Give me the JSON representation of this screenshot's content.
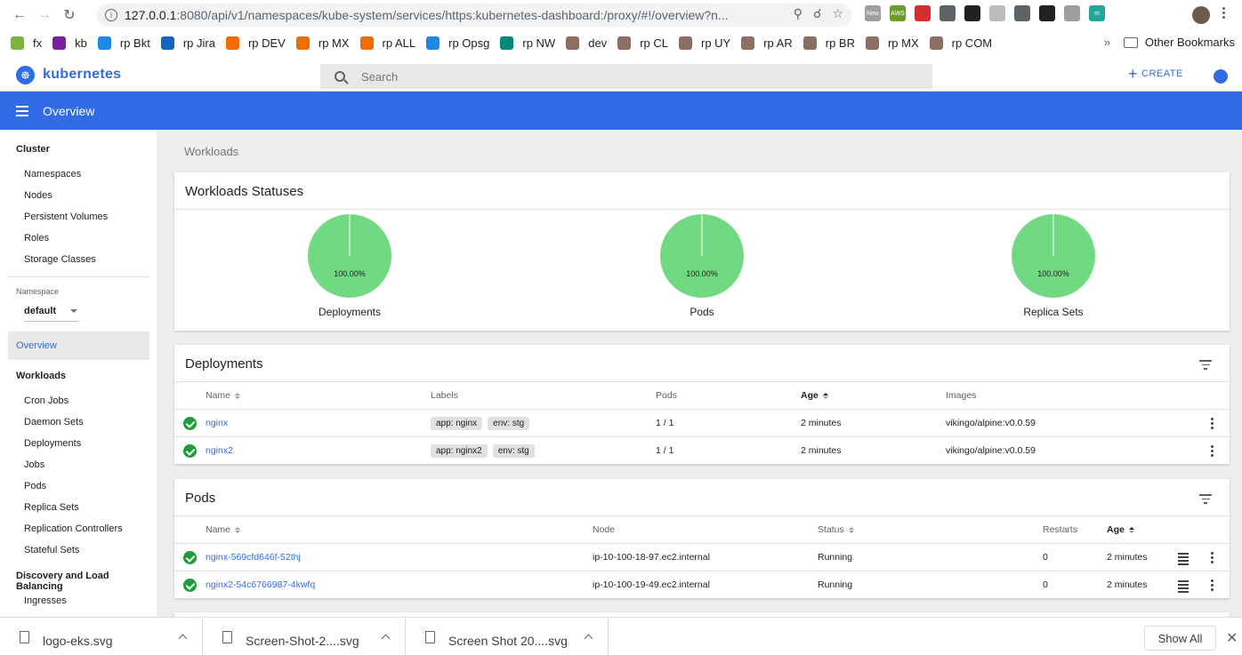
{
  "browser": {
    "url_host": "127.0.0.1",
    "url_rest": ":8080/api/v1/namespaces/kube-system/services/https:kubernetes-dashboard:/proxy/#!/overview?n...",
    "extensions": [
      {
        "label": "New",
        "color": "#9e9e9e"
      },
      {
        "label": "AWS",
        "color": "#6b9c2e"
      },
      {
        "label": "",
        "color": "#d32f2f"
      },
      {
        "label": "",
        "color": "#5f6368"
      },
      {
        "label": "",
        "color": "#212121"
      },
      {
        "label": "",
        "color": "#bdbdbd"
      },
      {
        "label": "",
        "color": "#5f6368"
      },
      {
        "label": "",
        "color": "#212121"
      },
      {
        "label": "",
        "color": "#9e9e9e"
      },
      {
        "label": "m",
        "color": "#26a69a"
      }
    ]
  },
  "bookmarks": {
    "items": [
      {
        "label": "fx",
        "color": "#7cb342"
      },
      {
        "label": "kb",
        "color": "#7b1fa2"
      },
      {
        "label": "rp Bkt",
        "color": "#1e88e5"
      },
      {
        "label": "rp Jira",
        "color": "#1565c0"
      },
      {
        "label": "rp DEV",
        "color": "#ef6c00"
      },
      {
        "label": "rp MX",
        "color": "#ef6c00"
      },
      {
        "label": "rp ALL",
        "color": "#ef6c00"
      },
      {
        "label": "rp Opsg",
        "color": "#1e88e5"
      },
      {
        "label": "rp NW",
        "color": "#00897b"
      },
      {
        "label": "dev",
        "color": "#8d6e63"
      },
      {
        "label": "rp CL",
        "color": "#8d6e63"
      },
      {
        "label": "rp UY",
        "color": "#8d6e63"
      },
      {
        "label": "rp AR",
        "color": "#8d6e63"
      },
      {
        "label": "rp BR",
        "color": "#8d6e63"
      },
      {
        "label": "rp MX",
        "color": "#8d6e63"
      },
      {
        "label": "rp COM",
        "color": "#8d6e63"
      }
    ],
    "more": "»",
    "other": "Other Bookmarks"
  },
  "header": {
    "brand": "kubernetes",
    "search_placeholder": "Search",
    "create_label": "CREATE"
  },
  "toolbar": {
    "title": "Overview"
  },
  "sidebar": {
    "cluster_heading": "Cluster",
    "cluster_items": [
      "Namespaces",
      "Nodes",
      "Persistent Volumes",
      "Roles",
      "Storage Classes"
    ],
    "namespace_label": "Namespace",
    "namespace_value": "default",
    "overview": "Overview",
    "workloads_heading": "Workloads",
    "workloads_items": [
      "Cron Jobs",
      "Daemon Sets",
      "Deployments",
      "Jobs",
      "Pods",
      "Replica Sets",
      "Replication Controllers",
      "Stateful Sets"
    ],
    "discovery_heading": "Discovery and Load Balancing",
    "discovery_items": [
      "Ingresses"
    ]
  },
  "main": {
    "breadcrumb": "Workloads",
    "statuses": {
      "title": "Workloads Statuses",
      "pies": [
        {
          "label": "Deployments",
          "percent": 100,
          "percent_text": "100.00%"
        },
        {
          "label": "Pods",
          "percent": 100,
          "percent_text": "100.00%"
        },
        {
          "label": "Replica Sets",
          "percent": 100,
          "percent_text": "100.00%"
        }
      ],
      "color": "#72d983"
    },
    "deployments": {
      "title": "Deployments",
      "columns": {
        "name": "Name",
        "labels": "Labels",
        "pods": "Pods",
        "age": "Age",
        "images": "Images"
      },
      "rows": [
        {
          "name": "nginx",
          "labels": [
            "app: nginx",
            "env: stg"
          ],
          "pods": "1 / 1",
          "age": "2 minutes",
          "images": "vikingo/alpine:v0.0.59"
        },
        {
          "name": "nginx2",
          "labels": [
            "app: nginx2",
            "env: stg"
          ],
          "pods": "1 / 1",
          "age": "2 minutes",
          "images": "vikingo/alpine:v0.0.59"
        }
      ]
    },
    "pods": {
      "title": "Pods",
      "columns": {
        "name": "Name",
        "node": "Node",
        "status": "Status",
        "restarts": "Restarts",
        "age": "Age"
      },
      "rows": [
        {
          "name": "nginx-569cfd646f-52thj",
          "node": "ip-10-100-18-97.ec2.internal",
          "status": "Running",
          "restarts": "0",
          "age": "2 minutes"
        },
        {
          "name": "nginx2-54c6766987-4kwfq",
          "node": "ip-10-100-19-49.ec2.internal",
          "status": "Running",
          "restarts": "0",
          "age": "2 minutes"
        }
      ]
    }
  },
  "downloads": {
    "items": [
      "logo-eks.svg",
      "Screen-Shot-2....svg",
      "Screen Shot 20....svg"
    ],
    "show_all": "Show All",
    "close": "✕"
  }
}
